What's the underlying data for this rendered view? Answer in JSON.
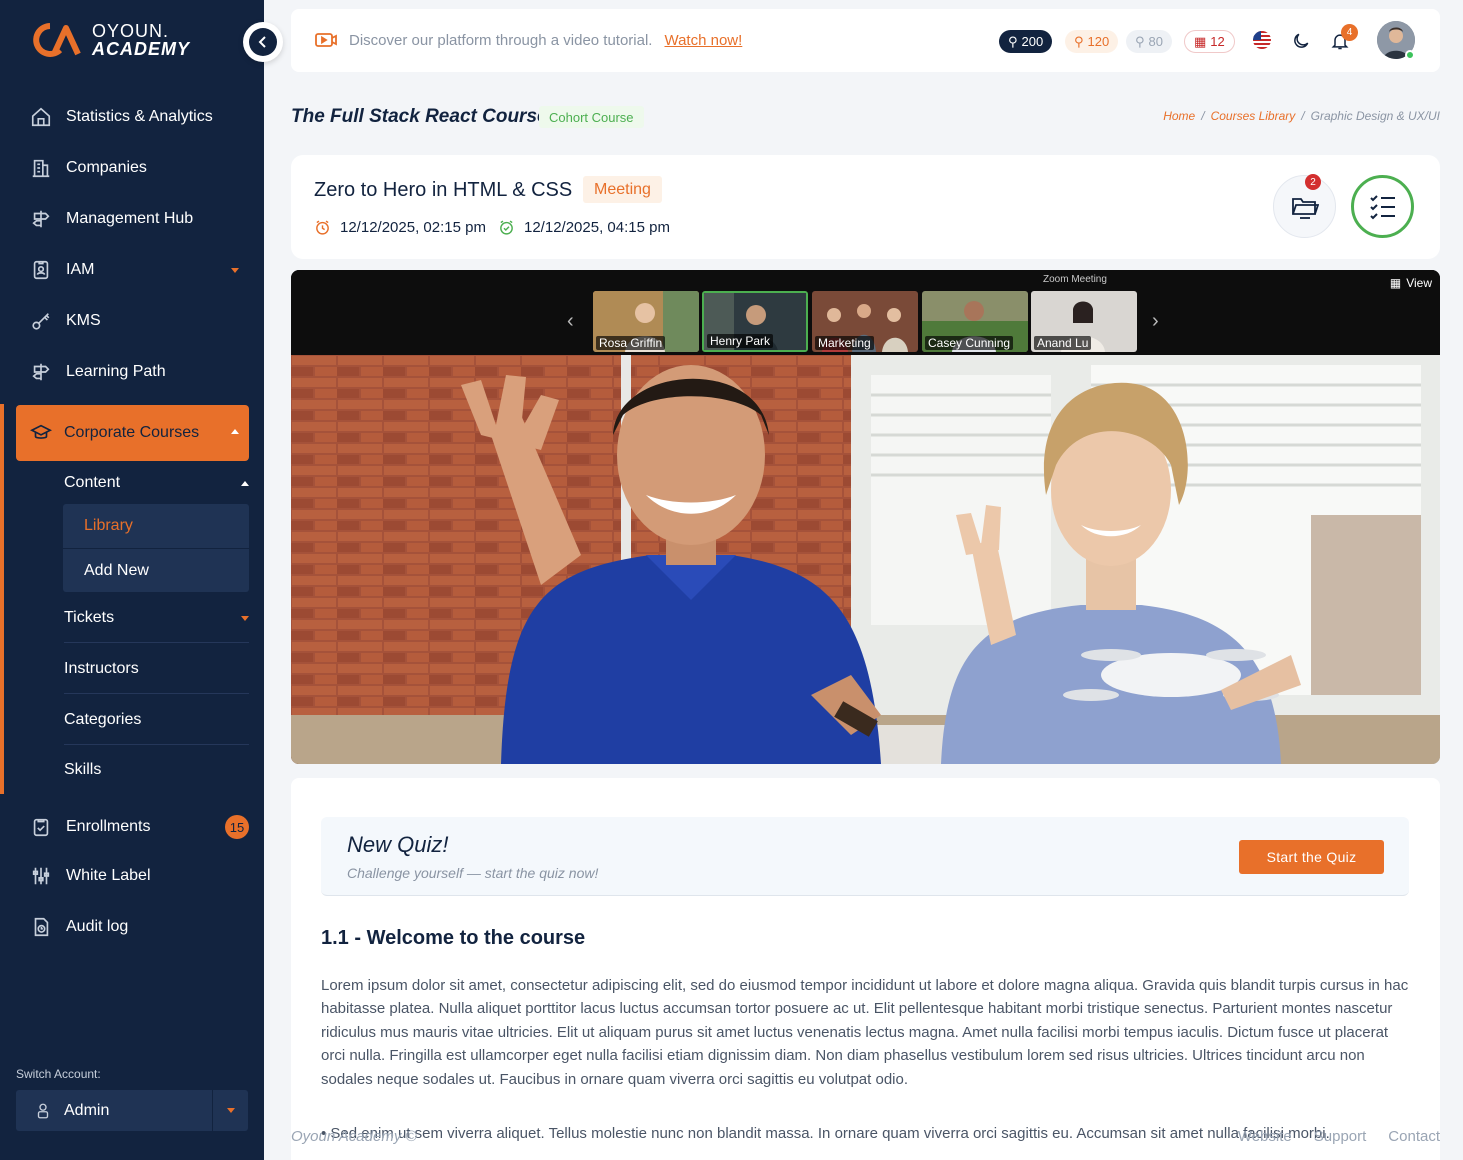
{
  "brand": {
    "line1": "OYOUN.",
    "line2": "ACADEMY"
  },
  "sidebar": {
    "items": [
      {
        "label": "Statistics & Analytics"
      },
      {
        "label": "Companies"
      },
      {
        "label": "Management Hub"
      },
      {
        "label": "IAM"
      },
      {
        "label": "KMS"
      },
      {
        "label": "Learning Path"
      },
      {
        "label": "Corporate Courses"
      },
      {
        "label": "Enrollments",
        "badge": "15"
      },
      {
        "label": "White Label"
      },
      {
        "label": "Audit log"
      }
    ],
    "sub": {
      "content": "Content",
      "library": "Library",
      "add_new": "Add New",
      "tickets": "Tickets",
      "instructors": "Instructors",
      "categories": "Categories",
      "skills": "Skills"
    },
    "switch_account_label": "Switch Account:",
    "account": "Admin"
  },
  "topbar": {
    "tutorial_text": "Discover our platform through a video tutorial.",
    "tutorial_link": "Watch now!",
    "pills": {
      "dark": "200",
      "orange": "120",
      "gray": "80",
      "red": "12"
    },
    "notifications": "4"
  },
  "page": {
    "title": "The Full Stack React Course",
    "tag": "Cohort Course",
    "breadcrumb": {
      "home": "Home",
      "sep1": "/",
      "library": "Courses Library",
      "sep2": "/",
      "current": "Graphic Design & UX/UI"
    }
  },
  "session": {
    "title": "Zero to Hero in HTML & CSS",
    "type": "Meeting",
    "start": "12/12/2025, 02:15 pm",
    "end": "12/12/2025, 04:15 pm",
    "files_badge": "2"
  },
  "video": {
    "zoom_label": "Zoom Meeting",
    "view_label": "View",
    "participants": [
      {
        "name": "Rosa Griffin"
      },
      {
        "name": "Henry Park"
      },
      {
        "name": "Marketing"
      },
      {
        "name": "Casey Cunning"
      },
      {
        "name": "Anand Lu"
      }
    ]
  },
  "quiz": {
    "title": "New Quiz!",
    "subtitle": "Challenge yourself — start the quiz now!",
    "button": "Start the Quiz"
  },
  "lesson": {
    "title": "1.1 -  Welcome to the course",
    "body": "Lorem ipsum dolor sit amet, consectetur adipiscing elit, sed do eiusmod tempor incididunt ut labore et dolore magna aliqua. Gravida quis blandit turpis cursus in hac habitasse platea. Nulla aliquet porttitor lacus luctus accumsan tortor posuere ac ut. Elit pellentesque habitant morbi tristique senectus. Parturient montes nascetur ridiculus mus mauris vitae ultricies. Elit ut aliquam purus sit amet luctus venenatis lectus magna. Amet nulla facilisi morbi tempus iaculis. Dictum fusce ut placerat orci nulla. Fringilla est ullamcorper eget nulla facilisi etiam dignissim diam. Non diam phasellus vestibulum lorem sed risus ultricies. Ultrices tincidunt arcu non sodales neque sodales ut. Faucibus in ornare quam viverra orci sagittis eu volutpat odio.",
    "bullet": "•  Sed enim ut sem viverra aliquet. Tellus molestie nunc non blandit massa. In ornare quam viverra orci sagittis eu. Accumsan sit amet nulla facilisi morbi."
  },
  "footer": {
    "copyright": "Oyoun Academy ©",
    "links": [
      "Website",
      "Support",
      "Contact"
    ]
  },
  "colors": {
    "navy": "#12233f",
    "accent": "#e8702a",
    "green": "#4caf50"
  }
}
